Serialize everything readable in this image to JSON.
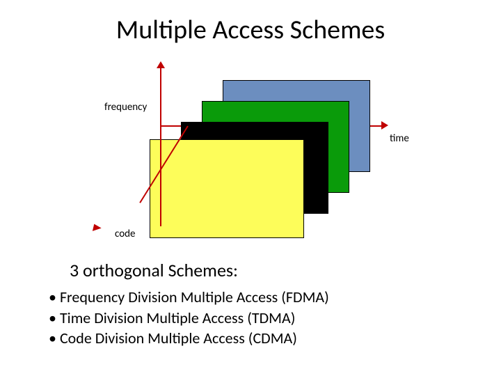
{
  "title": "Multiple Access Schemes",
  "axes": {
    "frequency": "frequency",
    "time": "time",
    "code": "code"
  },
  "planes": {
    "blue": "#6c8ebf",
    "green": "#0a9b0a",
    "black": "#000000",
    "yellow": "#fdfd5a"
  },
  "subheading": "3 orthogonal Schemes:",
  "bullets": [
    "Frequency Division Multiple Access (FDMA)",
    "Time Division Multiple Access (TDMA)",
    "Code Division Multiple Access (CDMA)"
  ]
}
